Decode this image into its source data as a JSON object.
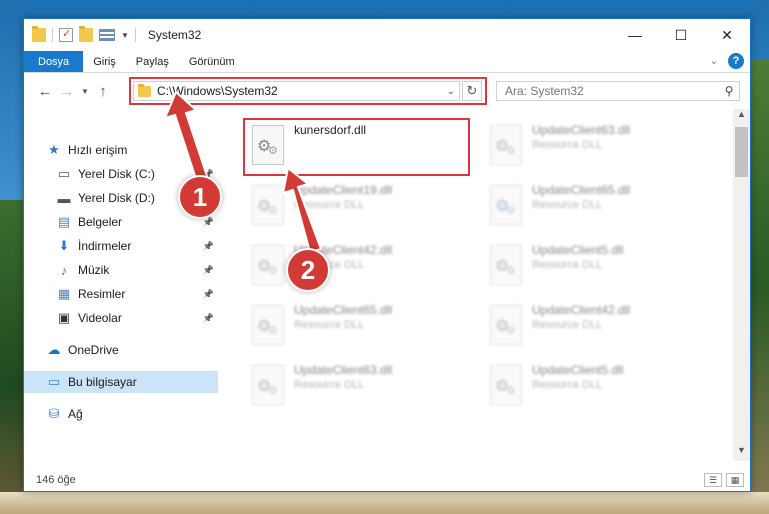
{
  "window": {
    "title": "System32",
    "controls": {
      "minimize": "—",
      "maximize": "☐",
      "close": "✕"
    }
  },
  "ribbon": {
    "file_tab": "Dosya",
    "tabs": [
      "Giriş",
      "Paylaş",
      "Görünüm"
    ]
  },
  "nav": {
    "address": "C:\\Windows\\System32",
    "search_placeholder": "Ara: System32"
  },
  "sidebar": {
    "items": [
      {
        "label": "Hızlı erişim",
        "icon": "star-icon",
        "glyph": "★",
        "color": "#2b7bd3"
      },
      {
        "label": "Yerel Disk (C:)",
        "icon": "drive-icon",
        "glyph": "▭",
        "color": "#555555",
        "pinned": true
      },
      {
        "label": "Yerel Disk (D:)",
        "icon": "drive-icon",
        "glyph": "▬",
        "color": "#555555",
        "pinned": true
      },
      {
        "label": "Belgeler",
        "icon": "documents-icon",
        "glyph": "▤",
        "color": "#4a7fc1",
        "pinned": true
      },
      {
        "label": "İndirmeler",
        "icon": "download-icon",
        "glyph": "⬇",
        "color": "#2b7bd3",
        "pinned": true
      },
      {
        "label": "Müzik",
        "icon": "music-icon",
        "glyph": "♪",
        "color": "#2b7bd3",
        "pinned": true
      },
      {
        "label": "Resimler",
        "icon": "pictures-icon",
        "glyph": "▦",
        "color": "#4a7fc1",
        "pinned": true
      },
      {
        "label": "Videolar",
        "icon": "videos-icon",
        "glyph": "▣",
        "color": "#333333",
        "pinned": true
      },
      {
        "label": "OneDrive",
        "icon": "onedrive-icon",
        "glyph": "☁",
        "color": "#1a73c9"
      },
      {
        "label": "Bu bilgisayar",
        "icon": "computer-icon",
        "glyph": "▭",
        "color": "#3b87d0",
        "selected": true
      },
      {
        "label": "Ağ",
        "icon": "network-icon",
        "glyph": "⛁",
        "color": "#3b87d0"
      }
    ]
  },
  "files": {
    "highlighted": {
      "name": "kunersdorf.dll",
      "type": ""
    },
    "blurred": [
      {
        "name": "UpdateClient63.dll",
        "type": "Resource DLL"
      },
      {
        "name": "UpdateClient19.dll",
        "type": "Resource DLL"
      },
      {
        "name": "UpdateClient65.dll",
        "type": "Resource DLL"
      },
      {
        "name": "UpdateClient42.dll",
        "type": "Resource DLL"
      },
      {
        "name": "UpdateClient5.dll",
        "type": "Resource DLL"
      },
      {
        "name": "UpdateClient65.dll",
        "type": "Resource DLL"
      },
      {
        "name": "UpdateClient42.dll",
        "type": "Resource DLL"
      },
      {
        "name": "UpdateClient63.dll",
        "type": "Resource DLL"
      },
      {
        "name": "UpdateClient5.dll",
        "type": "Resource DLL"
      }
    ]
  },
  "status": {
    "count": "146 öğe"
  },
  "annotations": {
    "step1": "1",
    "step2": "2",
    "color": "#d23b35"
  }
}
